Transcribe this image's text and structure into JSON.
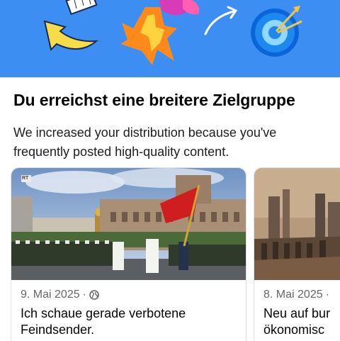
{
  "header": {
    "title": "Du erreichst eine breitere Zielgruppe",
    "description": "We increased your distribution because you've frequently posted high-quality content."
  },
  "hero": {
    "background_color": "#3d8ef2",
    "icons": [
      "arrow-icon",
      "rocket-icon",
      "target-icon"
    ]
  },
  "posts": [
    {
      "date": "9. Mai 2025",
      "separator": "·",
      "audience_icon": "globe-icon",
      "title_line1": "Ich schaue gerade verbotene",
      "title_line2": "Feindsender.",
      "image_badge": "RT"
    },
    {
      "date": "8. Mai 2025",
      "separator": "·",
      "title_line1": "Neu auf bur",
      "title_line2": "ökonomisc"
    }
  ]
}
